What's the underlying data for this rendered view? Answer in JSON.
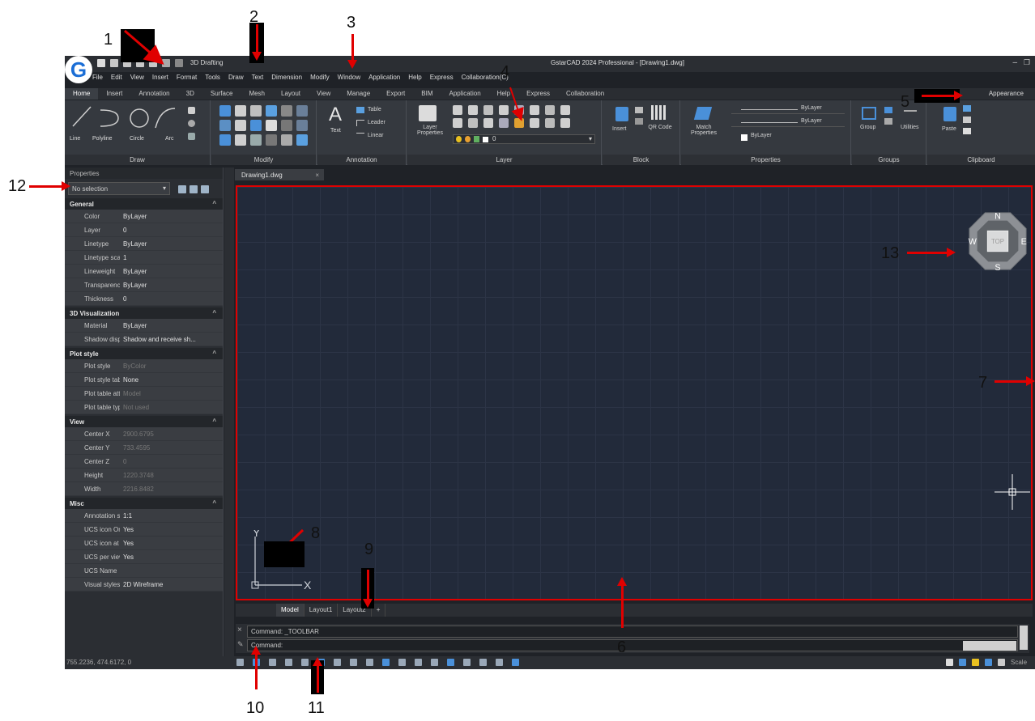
{
  "window": {
    "title": "GstarCAD 2024 Professional - [Drawing1.dwg]",
    "workspace": "3D Drafting"
  },
  "menubar": [
    "File",
    "Edit",
    "View",
    "Insert",
    "Format",
    "Tools",
    "Draw",
    "Text",
    "Dimension",
    "Modify",
    "Window",
    "Application",
    "Help",
    "Express",
    "Collaboration(C)"
  ],
  "ribbon_tabs": [
    "Home",
    "Insert",
    "Annotation",
    "3D",
    "Surface",
    "Mesh",
    "Layout",
    "View",
    "Manage",
    "Export",
    "BIM",
    "Application",
    "Help",
    "Express",
    "Collaboration"
  ],
  "appearance_label": "Appearance",
  "ribbon_panels": {
    "draw": {
      "label": "Draw",
      "buttons": [
        "Line",
        "Polyline",
        "Circle",
        "Arc"
      ]
    },
    "modify": {
      "label": "Modify"
    },
    "annotation": {
      "label": "Annotation",
      "buttons": [
        "Text",
        "Table",
        "Leader",
        "Linear"
      ]
    },
    "layer": {
      "label": "Layer",
      "buttons": [
        "Layer Properties"
      ],
      "current": "0"
    },
    "block": {
      "label": "Block",
      "buttons": [
        "Insert",
        "QR Code"
      ]
    },
    "properties": {
      "label": "Properties",
      "buttons": [
        "Match Properties"
      ],
      "values": [
        "ByLayer",
        "ByLayer",
        "ByLayer"
      ]
    },
    "groups": {
      "label": "Groups",
      "buttons": [
        "Group"
      ]
    },
    "utilities": {
      "buttons": [
        "Utilities"
      ]
    },
    "clipboard": {
      "label": "Clipboard",
      "buttons": [
        "Paste"
      ]
    }
  },
  "properties_panel": {
    "title": "Properties",
    "selection": "No selection",
    "sections": [
      {
        "name": "General",
        "rows": [
          [
            "Color",
            "ByLayer"
          ],
          [
            "Layer",
            "0"
          ],
          [
            "Linetype",
            "ByLayer"
          ],
          [
            "Linetype scale",
            "1"
          ],
          [
            "Lineweight",
            "ByLayer"
          ],
          [
            "Transparency",
            "ByLayer"
          ],
          [
            "Thickness",
            "0"
          ]
        ]
      },
      {
        "name": "3D Visualization",
        "rows": [
          [
            "Material",
            "ByLayer"
          ],
          [
            "Shadow display",
            "Shadow and receive sh..."
          ]
        ]
      },
      {
        "name": "Plot style",
        "rows": [
          [
            "Plot style",
            "ByColor"
          ],
          [
            "Plot style table",
            "None"
          ],
          [
            "Plot table atta...",
            "Model"
          ],
          [
            "Plot table type",
            "Not used"
          ]
        ]
      },
      {
        "name": "View",
        "rows": [
          [
            "Center X",
            "2900.6795"
          ],
          [
            "Center Y",
            "733.4595"
          ],
          [
            "Center Z",
            "0"
          ],
          [
            "Height",
            "1220.3748"
          ],
          [
            "Width",
            "2216.8482"
          ]
        ]
      },
      {
        "name": "Misc",
        "rows": [
          [
            "Annotation sc...",
            "1:1"
          ],
          [
            "UCS icon On",
            "Yes"
          ],
          [
            "UCS icon at o...",
            "Yes"
          ],
          [
            "UCS per view...",
            "Yes"
          ],
          [
            "UCS Name",
            ""
          ],
          [
            "Visual styles",
            "2D Wireframe"
          ]
        ]
      }
    ]
  },
  "document_tab": "Drawing1.dwg",
  "viewcube": {
    "n": "N",
    "s": "S",
    "e": "E",
    "w": "W",
    "top": "TOP"
  },
  "ucs": {
    "x": "X",
    "y": "Y"
  },
  "layout_tabs": [
    "Model",
    "Layout1",
    "Layout2",
    "+"
  ],
  "command_lines": [
    "Command: _TOOLBAR",
    "Command:"
  ],
  "status_coords": "755.2236, 474.6172, 0",
  "status_right": "Scale",
  "annotations": [
    "1",
    "2",
    "3",
    "4",
    "5",
    "6",
    "7",
    "8",
    "9",
    "10",
    "11",
    "12",
    "13"
  ],
  "colors": {
    "annotation_arrow": "#e00000",
    "canvas": "#222a3a",
    "accent": "#1b6ed6"
  }
}
